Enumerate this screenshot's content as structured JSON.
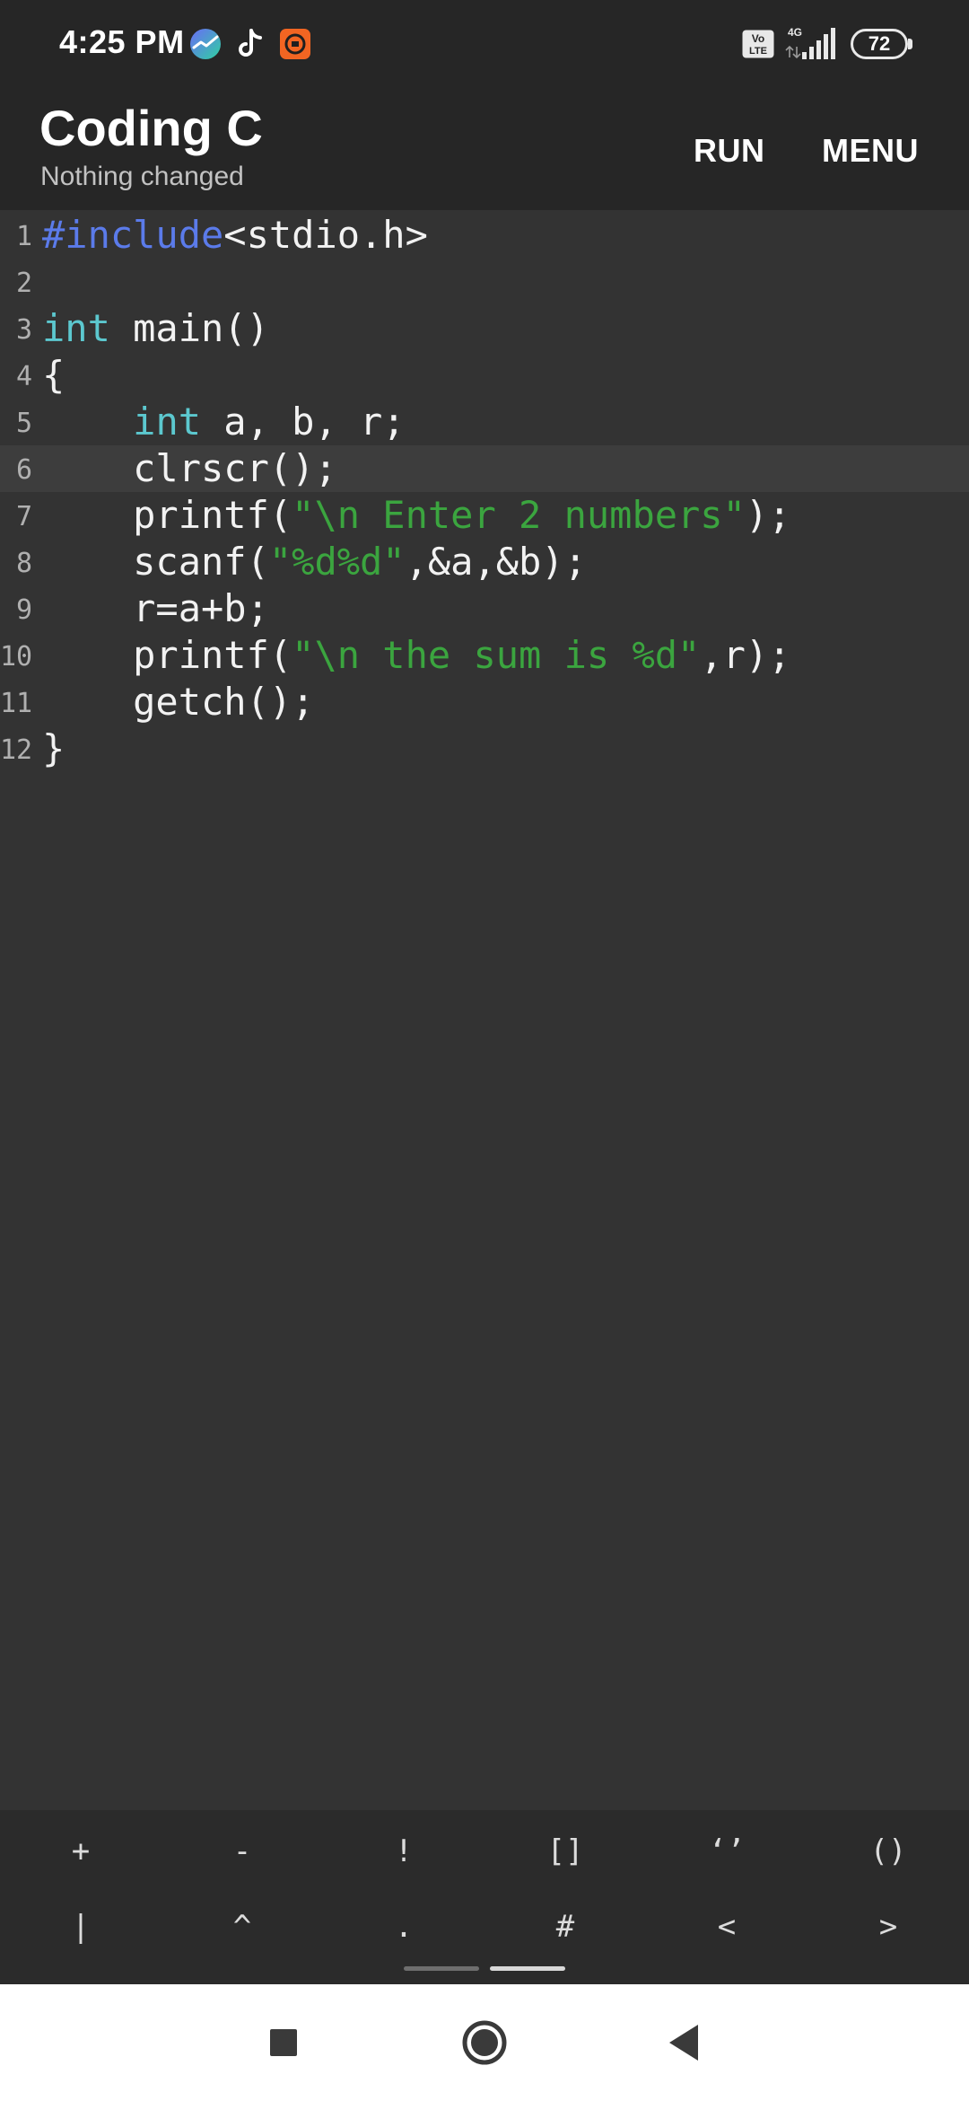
{
  "status_bar": {
    "time": "4:25 PM",
    "app_icons": [
      "chart-app-icon",
      "tiktok-icon",
      "recorder-app-icon"
    ],
    "network_badge": "Vo LTE",
    "network_type": "4G",
    "battery_level": "72"
  },
  "app_bar": {
    "title": "Coding C",
    "subtitle": "Nothing changed",
    "run_label": "RUN",
    "menu_label": "MENU"
  },
  "editor": {
    "current_line": 6,
    "lines": [
      {
        "number": "1",
        "tokens": [
          {
            "t": "#include",
            "k": "pp"
          },
          {
            "t": "<stdio.h>",
            "k": "plain"
          }
        ]
      },
      {
        "number": "2",
        "tokens": []
      },
      {
        "number": "3",
        "tokens": [
          {
            "t": "int",
            "k": "kw"
          },
          {
            "t": " main()",
            "k": "plain"
          }
        ]
      },
      {
        "number": "4",
        "tokens": [
          {
            "t": "{",
            "k": "plain"
          }
        ]
      },
      {
        "number": "5",
        "tokens": [
          {
            "t": "    ",
            "k": "plain"
          },
          {
            "t": "int",
            "k": "kw"
          },
          {
            "t": " a, b, r;",
            "k": "plain"
          }
        ]
      },
      {
        "number": "6",
        "tokens": [
          {
            "t": "    clrscr();",
            "k": "plain"
          }
        ]
      },
      {
        "number": "7",
        "tokens": [
          {
            "t": "    printf(",
            "k": "plain"
          },
          {
            "t": "\"\\n Enter 2 numbers\"",
            "k": "str"
          },
          {
            "t": ");",
            "k": "plain"
          }
        ]
      },
      {
        "number": "8",
        "tokens": [
          {
            "t": "    scanf(",
            "k": "plain"
          },
          {
            "t": "\"%d%d\"",
            "k": "str"
          },
          {
            "t": ",&a,&b);",
            "k": "plain"
          }
        ]
      },
      {
        "number": "9",
        "tokens": [
          {
            "t": "    r=a+b;",
            "k": "plain"
          }
        ]
      },
      {
        "number": "10",
        "tokens": [
          {
            "t": "    printf(",
            "k": "plain"
          },
          {
            "t": "\"\\n the sum is %d\"",
            "k": "str"
          },
          {
            "t": ",r);",
            "k": "plain"
          }
        ]
      },
      {
        "number": "11",
        "tokens": [
          {
            "t": "    getch();",
            "k": "plain"
          }
        ]
      },
      {
        "number": "12",
        "tokens": [
          {
            "t": "}",
            "k": "plain"
          }
        ]
      }
    ]
  },
  "symbol_bar": {
    "rows": [
      [
        {
          "label": "+",
          "name": "plus"
        },
        {
          "label": "-",
          "name": "minus"
        },
        {
          "label": "!",
          "name": "exclamation"
        },
        {
          "label": "[]",
          "name": "brackets"
        },
        {
          "label": "‘’",
          "name": "quotes"
        },
        {
          "label": "()",
          "name": "parentheses"
        }
      ],
      [
        {
          "label": "|",
          "name": "pipe"
        },
        {
          "label": "^",
          "name": "caret"
        },
        {
          "label": ".",
          "name": "dot"
        },
        {
          "label": "#",
          "name": "hash"
        },
        {
          "label": "<",
          "name": "less-than"
        },
        {
          "label": ">",
          "name": "greater-than"
        }
      ]
    ],
    "page_count": 2,
    "active_page": 2
  },
  "nav_bar": {
    "buttons": [
      "recent-apps-icon",
      "home-icon",
      "back-icon"
    ]
  },
  "colors": {
    "keyword": "#5cc8cf",
    "preprocessor": "#5b7bea",
    "string": "#3ba53f",
    "background": "#333333",
    "bar_background": "#262626"
  }
}
